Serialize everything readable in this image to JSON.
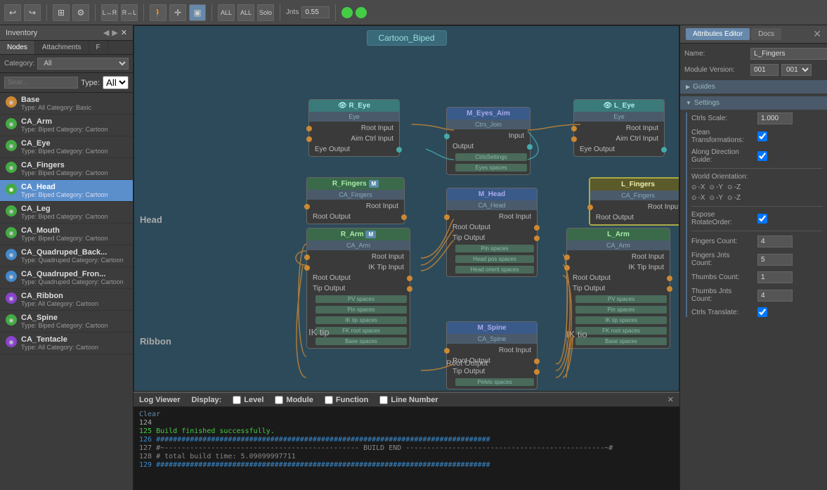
{
  "toolbar": {
    "buttons": [
      "↩",
      "↪",
      "⬛",
      "⚙",
      "↔",
      "↔"
    ],
    "jnts_label": "Jnts",
    "jnts_value": "0.55"
  },
  "inventory": {
    "title": "Inventory",
    "tabs": [
      "Nodes",
      "Attachments",
      "F"
    ],
    "category_label": "Category:",
    "category_value": "All",
    "search_placeholder": "Sear...",
    "type_label": "Type:",
    "type_value": "All",
    "nodes": [
      {
        "name": "Base",
        "type": "Type: All  Category: Basic",
        "icon_color": "orange"
      },
      {
        "name": "CA_Arm",
        "type": "Type: Biped  Category: Cartoon",
        "icon_color": "green"
      },
      {
        "name": "CA_Eye",
        "type": "Type: Biped  Category: Cartoon",
        "icon_color": "green"
      },
      {
        "name": "CA_Fingers",
        "type": "Type: Biped  Category: Cartoon",
        "icon_color": "green"
      },
      {
        "name": "CA_Head",
        "type": "Type: Biped  Category: Cartoon",
        "icon_color": "green",
        "selected": true
      },
      {
        "name": "CA_Leg",
        "type": "Type: Biped  Category: Cartoon",
        "icon_color": "green"
      },
      {
        "name": "CA_Mouth",
        "type": "Type: Biped  Category: Cartoon",
        "icon_color": "green"
      },
      {
        "name": "CA_Quadruped_Back...",
        "type": "Type: Quadruped  Category: Cartoon",
        "icon_color": "blue"
      },
      {
        "name": "CA_Quadruped_Fron...",
        "type": "Type: Quadruped  Category: Cartoon",
        "icon_color": "blue"
      },
      {
        "name": "CA_Ribbon",
        "type": "Type: All  Category: Cartoon",
        "icon_color": "purple"
      },
      {
        "name": "CA_Spine",
        "type": "Type: Biped  Category: Cartoon",
        "icon_color": "green"
      },
      {
        "name": "CA_Tentacle",
        "type": "Type: All  Category: Cartoon",
        "icon_color": "purple"
      }
    ]
  },
  "node_editor": {
    "title": "Cartoon_Biped",
    "nodes": {
      "r_eye": {
        "label": "R_Eye",
        "sub": "Eye",
        "ports": [
          "Root Input",
          "Aim Ctrl Input",
          "Eye Output"
        ]
      },
      "m_eyes_aim": {
        "label": "M_Eyes_Aim",
        "sub": "Ctrs_Join",
        "ports": [
          "Input",
          "Output"
        ]
      },
      "l_eye": {
        "label": "L_Eye",
        "sub": "Eye",
        "ports": [
          "Root Input",
          "Aim Ctrl Input",
          "Eye Output"
        ]
      },
      "m_ctrls_settings": {
        "label": "CtrlsSettings",
        "sub": "Eyes spaces"
      },
      "r_fingers": {
        "label": "R_Fingers",
        "sub": "CA_Fingers",
        "badge": "M",
        "ports": [
          "Root Input",
          "Root Output"
        ]
      },
      "m_head": {
        "label": "M_Head",
        "sub": "CA_Head",
        "ports": [
          "Root Input",
          "Root Output",
          "Tip Output"
        ]
      },
      "l_fingers": {
        "label": "L_Fingers",
        "sub": "CA_Fingers",
        "ports": [
          "Root Input",
          "Root Output"
        ],
        "highlighted": true
      },
      "r_arm": {
        "label": "R_Arm",
        "sub": "CA_Arm",
        "badge": "M",
        "ports": [
          "Root Input",
          "IK Tip Input",
          "Root Output",
          "Tip Output",
          "Pin spaces",
          "IK tip spaces",
          "FK root spaces",
          "Base spaces",
          "PV spaces"
        ]
      },
      "l_arm": {
        "label": "L_Arm",
        "sub": "CA_Arm",
        "ports": [
          "Root Input",
          "IK Tip Input",
          "Root Output",
          "Tip Output",
          "Pin spaces",
          "IK tip spaces",
          "FK root spaces",
          "Base spaces",
          "PV spaces"
        ]
      },
      "m_spine": {
        "label": "M_Spine",
        "sub": "CA_Spine",
        "ports": [
          "Root Input",
          "Root Output",
          "Tip Output",
          "Pelvis spaces"
        ]
      },
      "head_node": {
        "label": "Head",
        "type": "head"
      }
    }
  },
  "attributes_editor": {
    "title": "Attributes Editor",
    "docs_tab": "Docs",
    "name_label": "Name:",
    "name_value": "L_Fingers",
    "module_version_label": "Module Version:",
    "module_version_value": "001",
    "sections": {
      "guides": {
        "label": "Guides",
        "collapsed": true
      },
      "settings": {
        "label": "Settings",
        "expanded": true
      }
    },
    "settings": {
      "ctrls_scale_label": "Ctrls Scale:",
      "ctrls_scale_value": "1.000",
      "clean_transformations_label": "Clean Transformations:",
      "clean_transformations_value": true,
      "along_direction_guide_label": "Along Direction Guide:",
      "along_direction_guide_value": true,
      "world_orientation_label": "World Orientation:",
      "world_orientation_x_neg": "-X",
      "world_orientation_y_neg": "-Y",
      "world_orientation_z_neg": "-Z",
      "world_orientation_x": "-X",
      "world_orientation_y": "-Y",
      "world_orientation_z": "-Z",
      "expose_rotate_order_label": "Expose RotateOrder:",
      "expose_rotate_order_value": true,
      "fingers_count_label": "Fingers Count:",
      "fingers_count_value": "4",
      "fingers_jnts_count_label": "Fingers Jnts Count:",
      "fingers_jnts_count_value": "5",
      "thumbs_count_label": "Thumbs Count:",
      "thumbs_count_value": "1",
      "thumbs_jnts_count_label": "Thumbs Jnts Count:",
      "thumbs_jnts_count_value": "4",
      "ctrls_translate_label": "Ctrls Translate:",
      "ctrls_translate_value": true
    }
  },
  "log_viewer": {
    "title": "Log Viewer",
    "display_label": "Display:",
    "options": [
      "Level",
      "Module",
      "Function",
      "Line Number"
    ],
    "lines": [
      {
        "num": "124",
        "text": "",
        "class": ""
      },
      {
        "num": "125",
        "text": "Build finished successfully.",
        "class": "success"
      },
      {
        "num": "126",
        "text": "###############################################################################",
        "class": "hash"
      },
      {
        "num": "127",
        "text": "#~---------------------------------------------- BUILD END -----------------------------------------------~#",
        "class": "comment"
      },
      {
        "num": "128",
        "text": "# total build time: 5.09099997711",
        "class": "comment"
      },
      {
        "num": "129",
        "text": "###############################################################################",
        "class": "hash"
      }
    ]
  }
}
